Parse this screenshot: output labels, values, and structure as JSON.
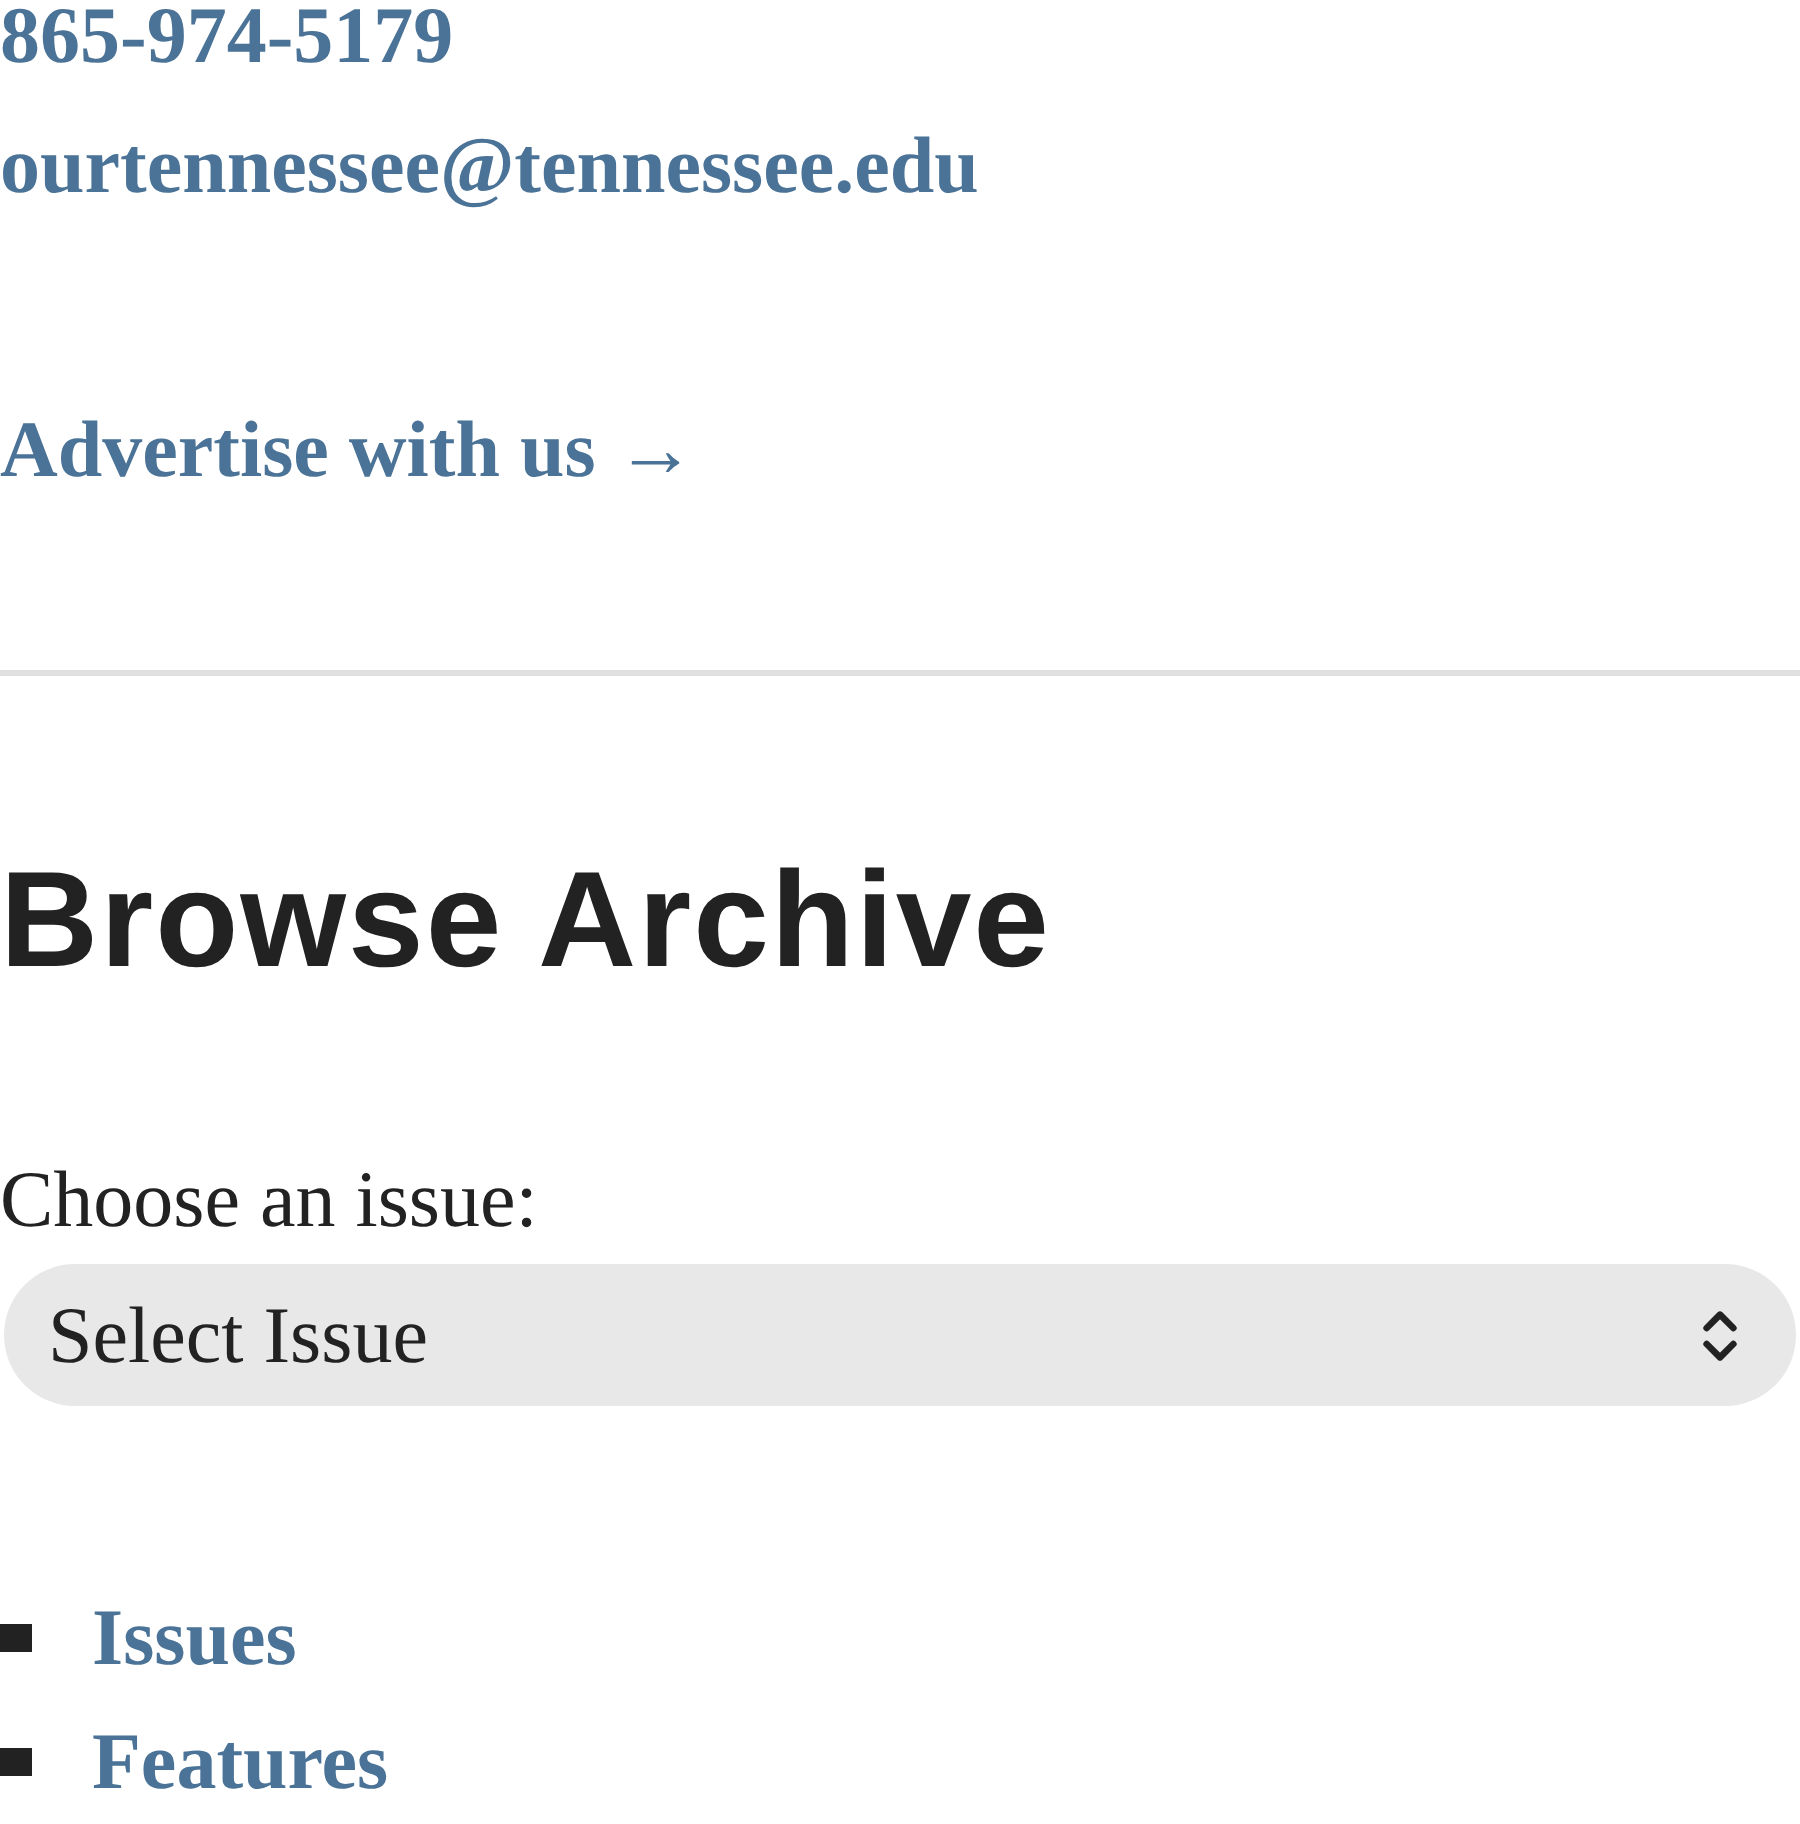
{
  "contact": {
    "phone": "865-974-5179",
    "email": "ourtennessee@tennessee.edu"
  },
  "advertise_link": "Advertise with us →",
  "archive": {
    "heading": "Browse Archive",
    "label": "Choose an issue:",
    "select": {
      "value": "Select Issue"
    }
  },
  "links": [
    {
      "label": "Issues"
    },
    {
      "label": "Features"
    }
  ]
}
